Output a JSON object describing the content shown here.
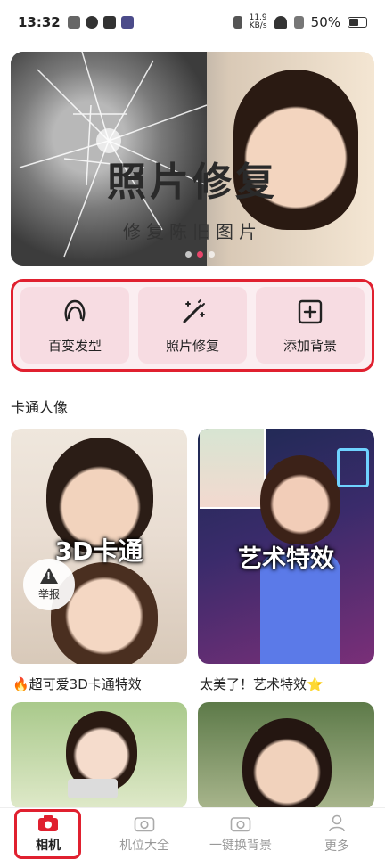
{
  "status": {
    "time": "13:32",
    "netspeed_top": "11.9",
    "netspeed_bottom": "KB/s",
    "battery": "50%"
  },
  "banner": {
    "title": "照片修复",
    "subtitle": "修复陈旧图片",
    "page_count": 3,
    "active_page": 2
  },
  "tools": [
    {
      "label": "百变发型",
      "icon": "hair-icon"
    },
    {
      "label": "照片修复",
      "icon": "magic-wand-icon"
    },
    {
      "label": "添加背景",
      "icon": "add-square-icon"
    }
  ],
  "section": {
    "title": "卡通人像"
  },
  "cards": [
    {
      "overlay": "3D卡通",
      "caption": "🔥超可爱3D卡通特效"
    },
    {
      "overlay": "艺术特效",
      "caption": "太美了！艺术特效⭐"
    }
  ],
  "report": {
    "label": "举报"
  },
  "nav": [
    {
      "label": "相机",
      "active": true,
      "icon": "camera-icon"
    },
    {
      "label": "机位大全",
      "active": false,
      "icon": "camera-outline-icon"
    },
    {
      "label": "一键换背景",
      "active": false,
      "icon": "camera-outline-icon"
    },
    {
      "label": "更多",
      "active": false,
      "icon": "person-icon"
    }
  ],
  "colors": {
    "accent": "#e8456a",
    "highlight_border": "#e0202f",
    "tool_bg": "#f7dce2"
  }
}
